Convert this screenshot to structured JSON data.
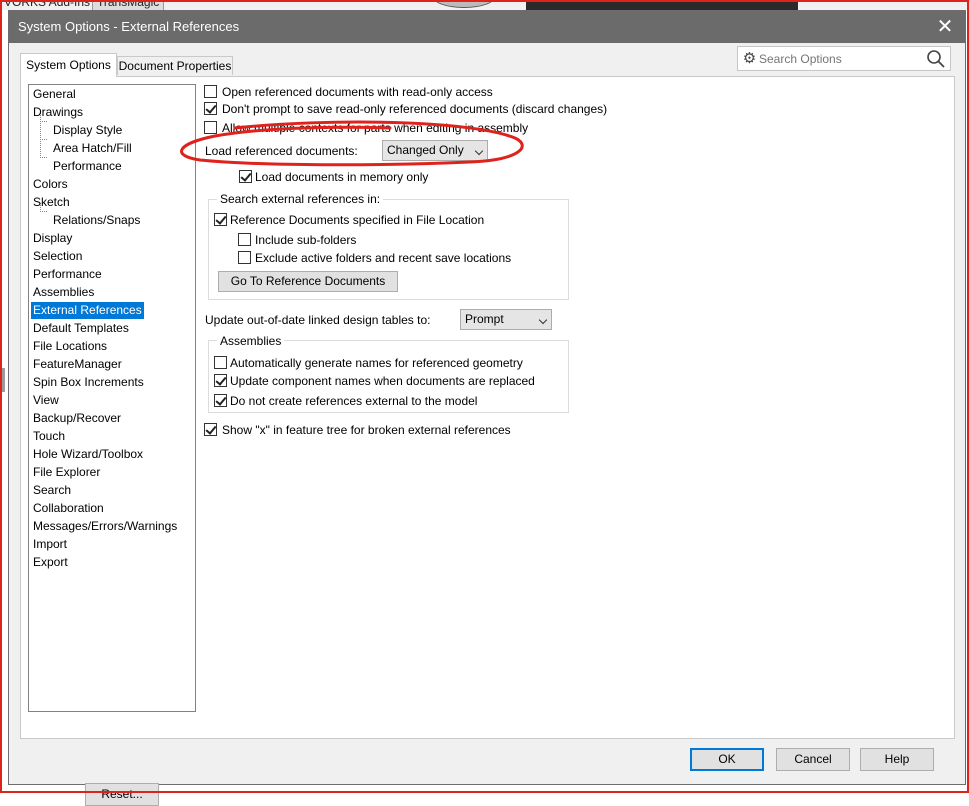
{
  "background": {
    "tab1": "VORKS Add-Ins",
    "tab2": "TransMagic"
  },
  "dialog": {
    "title": "System Options - External References",
    "close_glyph": "✕",
    "tabs": [
      {
        "label": "System Options",
        "active": true
      },
      {
        "label": "Document Properties",
        "active": false
      }
    ],
    "search": {
      "placeholder": "Search Options",
      "icon": "search-icon"
    }
  },
  "tree": {
    "items": [
      {
        "label": "General"
      },
      {
        "label": "Drawings"
      },
      {
        "label": "Display Style",
        "child": true
      },
      {
        "label": "Area Hatch/Fill",
        "child": true
      },
      {
        "label": "Performance",
        "child": true
      },
      {
        "label": "Colors"
      },
      {
        "label": "Sketch"
      },
      {
        "label": "Relations/Snaps",
        "child": true
      },
      {
        "label": "Display"
      },
      {
        "label": "Selection"
      },
      {
        "label": "Performance"
      },
      {
        "label": "Assemblies"
      },
      {
        "label": "External References",
        "selected": true
      },
      {
        "label": "Default Templates"
      },
      {
        "label": "File Locations"
      },
      {
        "label": "FeatureManager"
      },
      {
        "label": "Spin Box Increments"
      },
      {
        "label": "View"
      },
      {
        "label": "Backup/Recover"
      },
      {
        "label": "Touch"
      },
      {
        "label": "Hole Wizard/Toolbox"
      },
      {
        "label": "File Explorer"
      },
      {
        "label": "Search"
      },
      {
        "label": "Collaboration"
      },
      {
        "label": "Messages/Errors/Warnings"
      },
      {
        "label": "Import"
      },
      {
        "label": "Export"
      }
    ],
    "reset_label": "Reset..."
  },
  "options": {
    "open_readonly": {
      "label": "Open referenced documents with read-only access",
      "checked": false
    },
    "dont_prompt": {
      "label": "Don't prompt to save read-only referenced documents (discard changes)",
      "checked": true
    },
    "allow_multiple": {
      "label": "Allow multiple contexts for parts when editing in assembly",
      "checked": false
    },
    "load_referenced_label": "Load referenced documents:",
    "load_referenced_value": "Changed Only",
    "load_in_memory": {
      "label": "Load documents in memory only",
      "checked": true
    },
    "search_group": {
      "title": "Search external references in:",
      "reference_docs": {
        "label": "Reference Documents specified in File Location",
        "checked": true
      },
      "include_sub": {
        "label": "Include sub-folders",
        "checked": false
      },
      "exclude_active": {
        "label": "Exclude active folders and recent save locations",
        "checked": false
      },
      "goto_button": "Go To Reference Documents"
    },
    "update_tables_label": "Update out-of-date linked design tables to:",
    "update_tables_value": "Prompt",
    "assemblies_group": {
      "title": "Assemblies",
      "auto_generate": {
        "label": "Automatically generate names for referenced geometry",
        "checked": false
      },
      "update_component": {
        "label": "Update component names when documents are replaced",
        "checked": true
      },
      "do_not_create": {
        "label": "Do not create references external to the model",
        "checked": true
      }
    },
    "show_x": {
      "label": "Show \"x\" in feature tree for broken external references",
      "checked": true
    }
  },
  "footer": {
    "ok": "OK",
    "cancel": "Cancel",
    "help": "Help"
  },
  "colors": {
    "titlebar": "#6b6b6b",
    "selection": "#0078d7",
    "annotation": "#e0221c"
  }
}
